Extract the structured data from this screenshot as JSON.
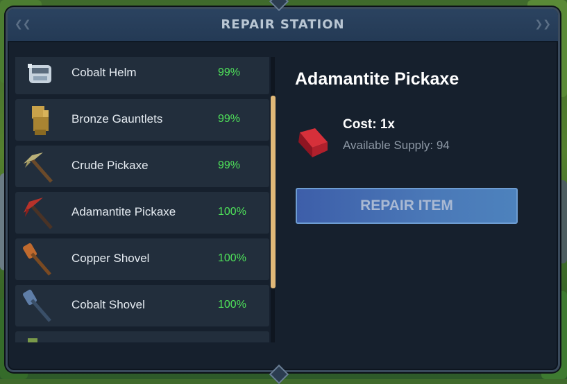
{
  "window": {
    "title": "REPAIR STATION"
  },
  "items": [
    {
      "name": "Cobalt Helm",
      "condition": "99%",
      "icon": "cobalt-helm-icon"
    },
    {
      "name": "Bronze Gauntlets",
      "condition": "99%",
      "icon": "bronze-gauntlets-icon"
    },
    {
      "name": "Crude Pickaxe",
      "condition": "99%",
      "icon": "crude-pickaxe-icon"
    },
    {
      "name": "Adamantite Pickaxe",
      "condition": "100%",
      "icon": "adamantite-pickaxe-icon"
    },
    {
      "name": "Copper Shovel",
      "condition": "100%",
      "icon": "copper-shovel-icon"
    },
    {
      "name": "Cobalt Shovel",
      "condition": "100%",
      "icon": "cobalt-shovel-icon"
    },
    {
      "name": "",
      "condition": "",
      "icon": "partial-item-icon"
    }
  ],
  "detail": {
    "title": "Adamantite Pickaxe",
    "cost": "Cost: 1x",
    "supply": "Available Supply: 94",
    "material_icon": "adamantite-bar-icon",
    "repair_button": "REPAIR ITEM"
  },
  "colors": {
    "accent_green": "#4fe35a",
    "scrollbar": "#e0b878",
    "button": "#4a78b7"
  }
}
